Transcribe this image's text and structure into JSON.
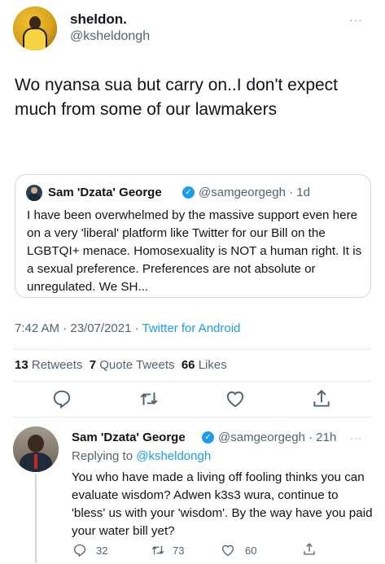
{
  "main_tweet": {
    "display_name": "sheldon.",
    "handle": "@ksheldongh",
    "more": "···",
    "text": "Wo nyansa sua but carry on..I don't expect much from some of our lawmakers",
    "timestamp": "7:42 AM · 23/07/2021 · ",
    "client": "Twitter for Android",
    "stats": {
      "retweets_count": "13",
      "retweets_label": " Retweets  ",
      "quotes_count": "7",
      "quotes_label": " Quote Tweets  ",
      "likes_count": "66",
      "likes_label": " Likes"
    }
  },
  "quoted_tweet": {
    "display_name": "Sam 'Dzata' George",
    "verified": "✓",
    "handle_time": "@samgeorgegh · 1d",
    "text": "I have been overwhelmed by the massive support even here on a very 'liberal' platform like Twitter for our Bill on the LGBTQI+ menace. Homosexuality is NOT a human right. It is a sexual preference. Preferences are not absolute or unregulated. We SH..."
  },
  "reply": {
    "display_name": "Sam 'Dzata' George",
    "verified": "✓",
    "handle_time": "@samgeorgegh · 21h",
    "more": "···",
    "replying_prefix": "Replying to ",
    "replying_to": "@ksheldongh",
    "text": "You who have made a living off fooling thinks you can evaluate wisdom? Adwen k3s3 wura, continue to 'bless' us with your 'wisdom'. By the way have you paid your water bill yet?",
    "counts": {
      "replies": "32",
      "retweets": "73",
      "likes": "60"
    }
  },
  "icons": {
    "reply": "reply-icon",
    "retweet": "retweet-icon",
    "like": "heart-icon",
    "share": "share-icon"
  },
  "colors": {
    "accent": "#1d9bf0",
    "muted": "#536471",
    "text": "#0f1419",
    "divider": "#e6ecf0"
  }
}
